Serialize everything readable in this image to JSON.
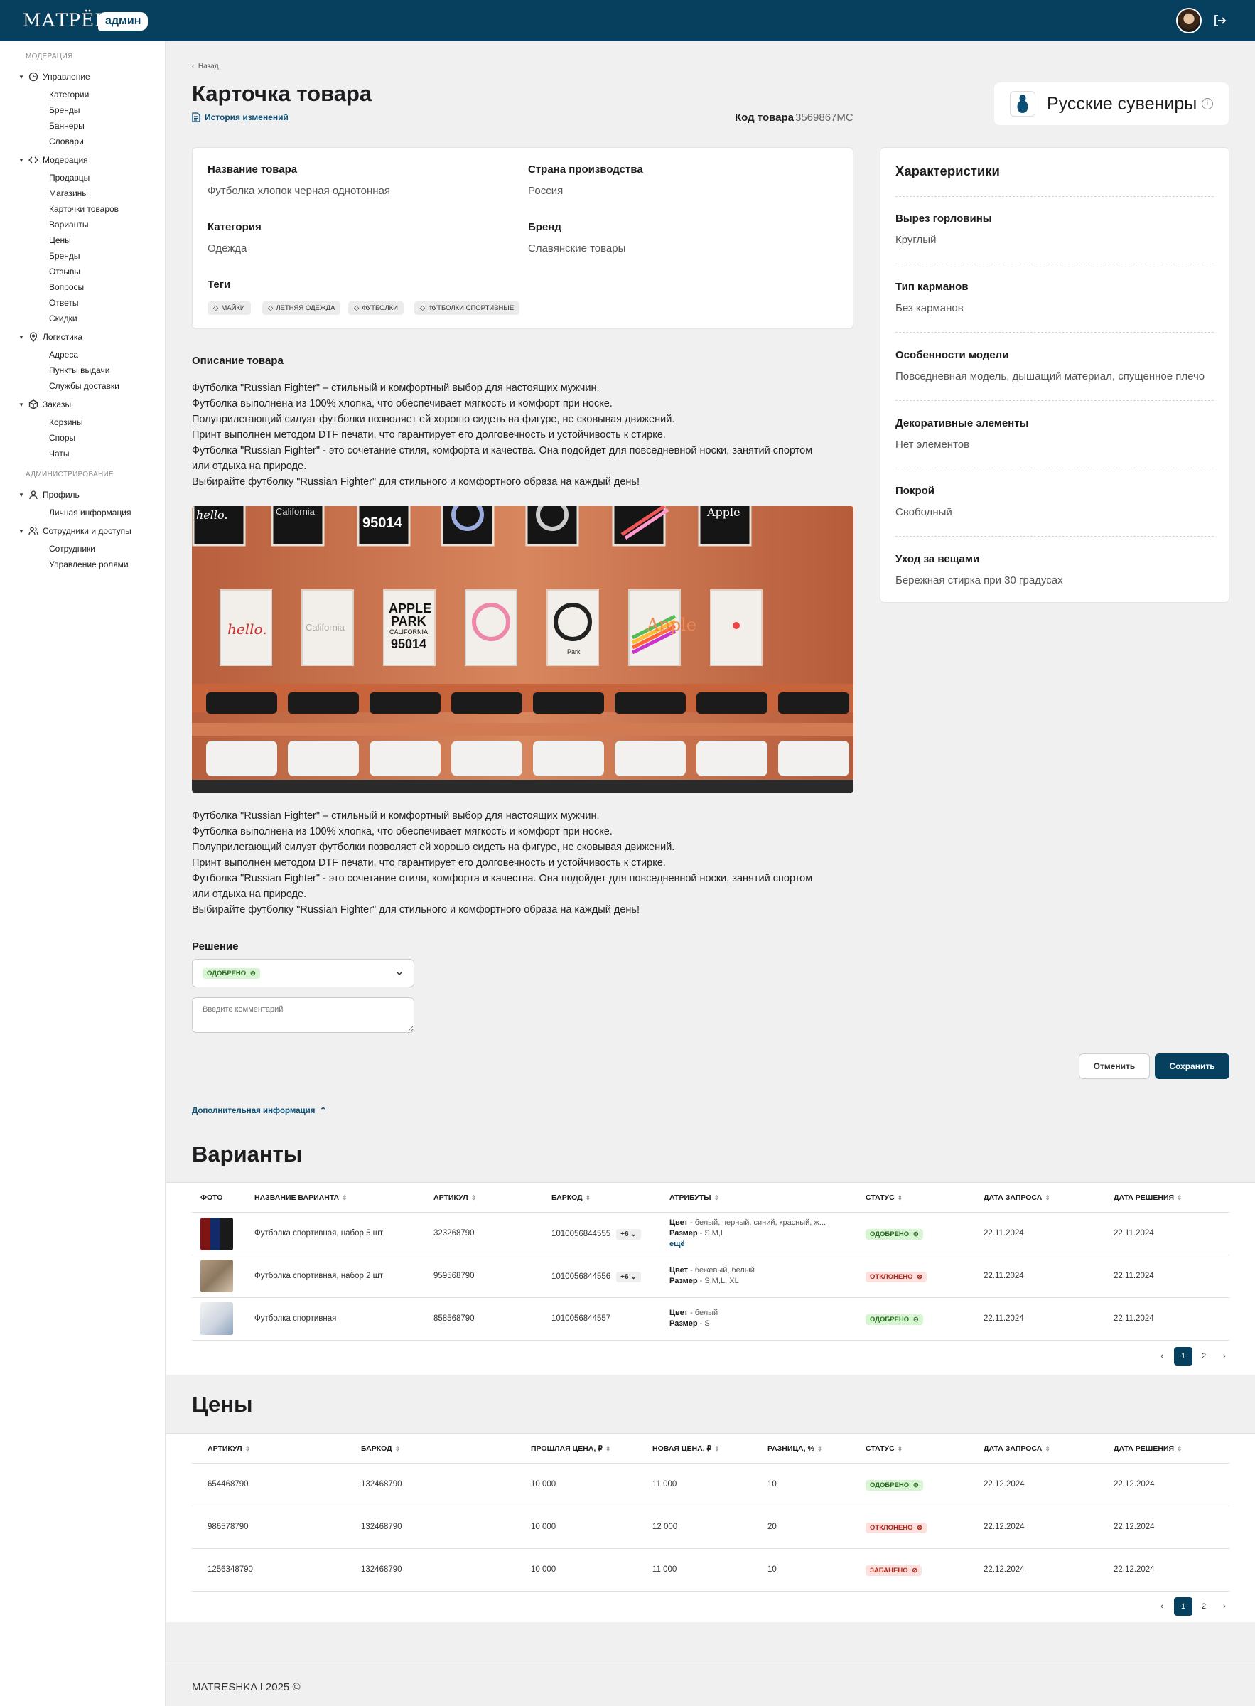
{
  "header": {
    "logo": "МАТРЁШКА",
    "badge": "админ"
  },
  "sidebar": {
    "section1": "МОДЕРАЦИЯ",
    "section2": "АДМИНИСТРИРОВАНИЕ",
    "groups": [
      {
        "label": "Управление",
        "items": [
          "Категории",
          "Бренды",
          "Баннеры",
          "Словари"
        ]
      },
      {
        "label": "Модерация",
        "items": [
          "Продавцы",
          "Магазины",
          "Карточки товаров",
          "Варианты",
          "Цены",
          "Бренды",
          "Отзывы",
          "Вопросы",
          "Ответы",
          "Скидки"
        ]
      },
      {
        "label": "Логистика",
        "items": [
          "Адреса",
          "Пункты выдачи",
          "Службы доставки"
        ]
      },
      {
        "label": "Заказы",
        "items": [
          "Корзины",
          "Споры",
          "Чаты"
        ]
      },
      {
        "label": "Профиль",
        "items": [
          "Личная информация"
        ]
      },
      {
        "label": "Сотрудники и доступы",
        "items": [
          "Сотрудники",
          "Управление ролями"
        ]
      }
    ]
  },
  "page": {
    "back": "Назад",
    "title": "Карточка товара",
    "history": "История изменений",
    "code_label": "Код товара",
    "code_value": "3569867MC",
    "shop_name": "Русские сувениры"
  },
  "product": {
    "name_label": "Название товара",
    "name_value": "Футболка хлопок черная однотонная",
    "country_label": "Страна производства",
    "country_value": "Россия",
    "category_label": "Категория",
    "category_value": "Одежда",
    "brand_label": "Бренд",
    "brand_value": "Славянские товары",
    "tags_label": "Теги",
    "tags": [
      "майки",
      "летняя одежда",
      "футболки",
      "футболки спортивные"
    ]
  },
  "characteristics": {
    "title": "Характеристики",
    "items": [
      {
        "label": "Вырез горловины",
        "value": "Круглый"
      },
      {
        "label": "Тип карманов",
        "value": "Без карманов"
      },
      {
        "label": "Особенности модели",
        "value": "Повседневная модель, дышащий материал, спущенное плечо"
      },
      {
        "label": "Декоративные элементы",
        "value": "Нет элементов"
      },
      {
        "label": "Покрой",
        "value": "Свободный"
      },
      {
        "label": "Уход за вещами",
        "value": "Бережная стирка при 30 градусах"
      }
    ]
  },
  "description": {
    "title": "Описание товара",
    "text": "Футболка \"Russian Fighter\" – стильный и комфортный выбор для настоящих мужчин.\nФутболка выполнена из 100% хлопка, что обеспечивает мягкость и комфорт при носке.\nПолуприлегающий силуэт футболки позволяет ей хорошо сидеть на фигуре, не сковывая движений.\nПринт  выполнен методом  DTF печати, что гарантирует его долговечность и устойчивость к стирке.\nФутболка \"Russian Fighter\" - это сочетание стиля, комфорта и качества. Она подойдет для повседневной носки, занятий спортом\nили отдыха на природе.\nВыбирайте футболку \"Russian Fighter\" для стильного и комфортного образа на каждый день!",
    "image_texts": [
      "hello.",
      "California",
      "APPLE",
      "PARK",
      "CALIFORNIA",
      "95014",
      "Park",
      "Apple"
    ]
  },
  "decision": {
    "title": "Решение",
    "selected": "одобрено",
    "comment_placeholder": "Введите комментарий",
    "cancel": "Отменить",
    "save": "Сохранить",
    "additional": "Дополнительная информация"
  },
  "variants": {
    "title": "Варианты",
    "columns": [
      "фото",
      "название варианта",
      "артикул",
      "баркод",
      "атрибуты",
      "статус",
      "дата запроса",
      "дата решения"
    ],
    "rows": [
      {
        "name": "Футболка спортивная, набор 5 шт",
        "article": "323268790",
        "barcode": "1010056844555",
        "plus": "+6",
        "color_label": "Цвет",
        "color": "белый, черный, синий, красный, ж...",
        "size_label": "Размер",
        "size": "S,M,L",
        "more": "ещё",
        "status": "одобрено",
        "req": "22.11.2024",
        "dec": "22.11.2024"
      },
      {
        "name": "Футболка спортивная, набор 2 шт",
        "article": "959568790",
        "barcode": "1010056844556",
        "plus": "+6",
        "color_label": "Цвет",
        "color": "бежевый, белый",
        "size_label": "Размер",
        "size": "S,M,L, XL",
        "status": "отклонено",
        "req": "22.11.2024",
        "dec": "22.11.2024"
      },
      {
        "name": "Футболка спортивная",
        "article": "858568790",
        "barcode": "1010056844557",
        "color_label": "Цвет",
        "color": "белый",
        "size_label": "Размер",
        "size": "S",
        "status": "одобрено",
        "req": "22.11.2024",
        "dec": "22.11.2024"
      }
    ],
    "pages": [
      "1",
      "2"
    ]
  },
  "prices": {
    "title": "Цены",
    "columns": [
      "артикул",
      "баркод",
      "прошлая цена, ₽",
      "новая цена, ₽",
      "разница, %",
      "статус",
      "дата запроса",
      "дата решения"
    ],
    "rows": [
      {
        "article": "654468790",
        "barcode": "132468790",
        "old": "10 000",
        "new": "11 000",
        "diff": "10",
        "status": "одобрено",
        "req": "22.12.2024",
        "dec": "22.12.2024"
      },
      {
        "article": "986578790",
        "barcode": "132468790",
        "old": "10 000",
        "new": "12 000",
        "diff": "20",
        "status": "отклонено",
        "req": "22.12.2024",
        "dec": "22.12.2024"
      },
      {
        "article": "1256348790",
        "barcode": "132468790",
        "old": "10 000",
        "new": "11 000",
        "diff": "10",
        "status": "забанено",
        "req": "22.12.2024",
        "dec": "22.12.2024"
      }
    ],
    "pages": [
      "1",
      "2"
    ]
  },
  "footer": {
    "text": "MATRESHKA I 2025 ©"
  },
  "colors": {
    "primary": "#073f5f",
    "approved": "#d8f5d3",
    "rejected": "#fde0de"
  }
}
